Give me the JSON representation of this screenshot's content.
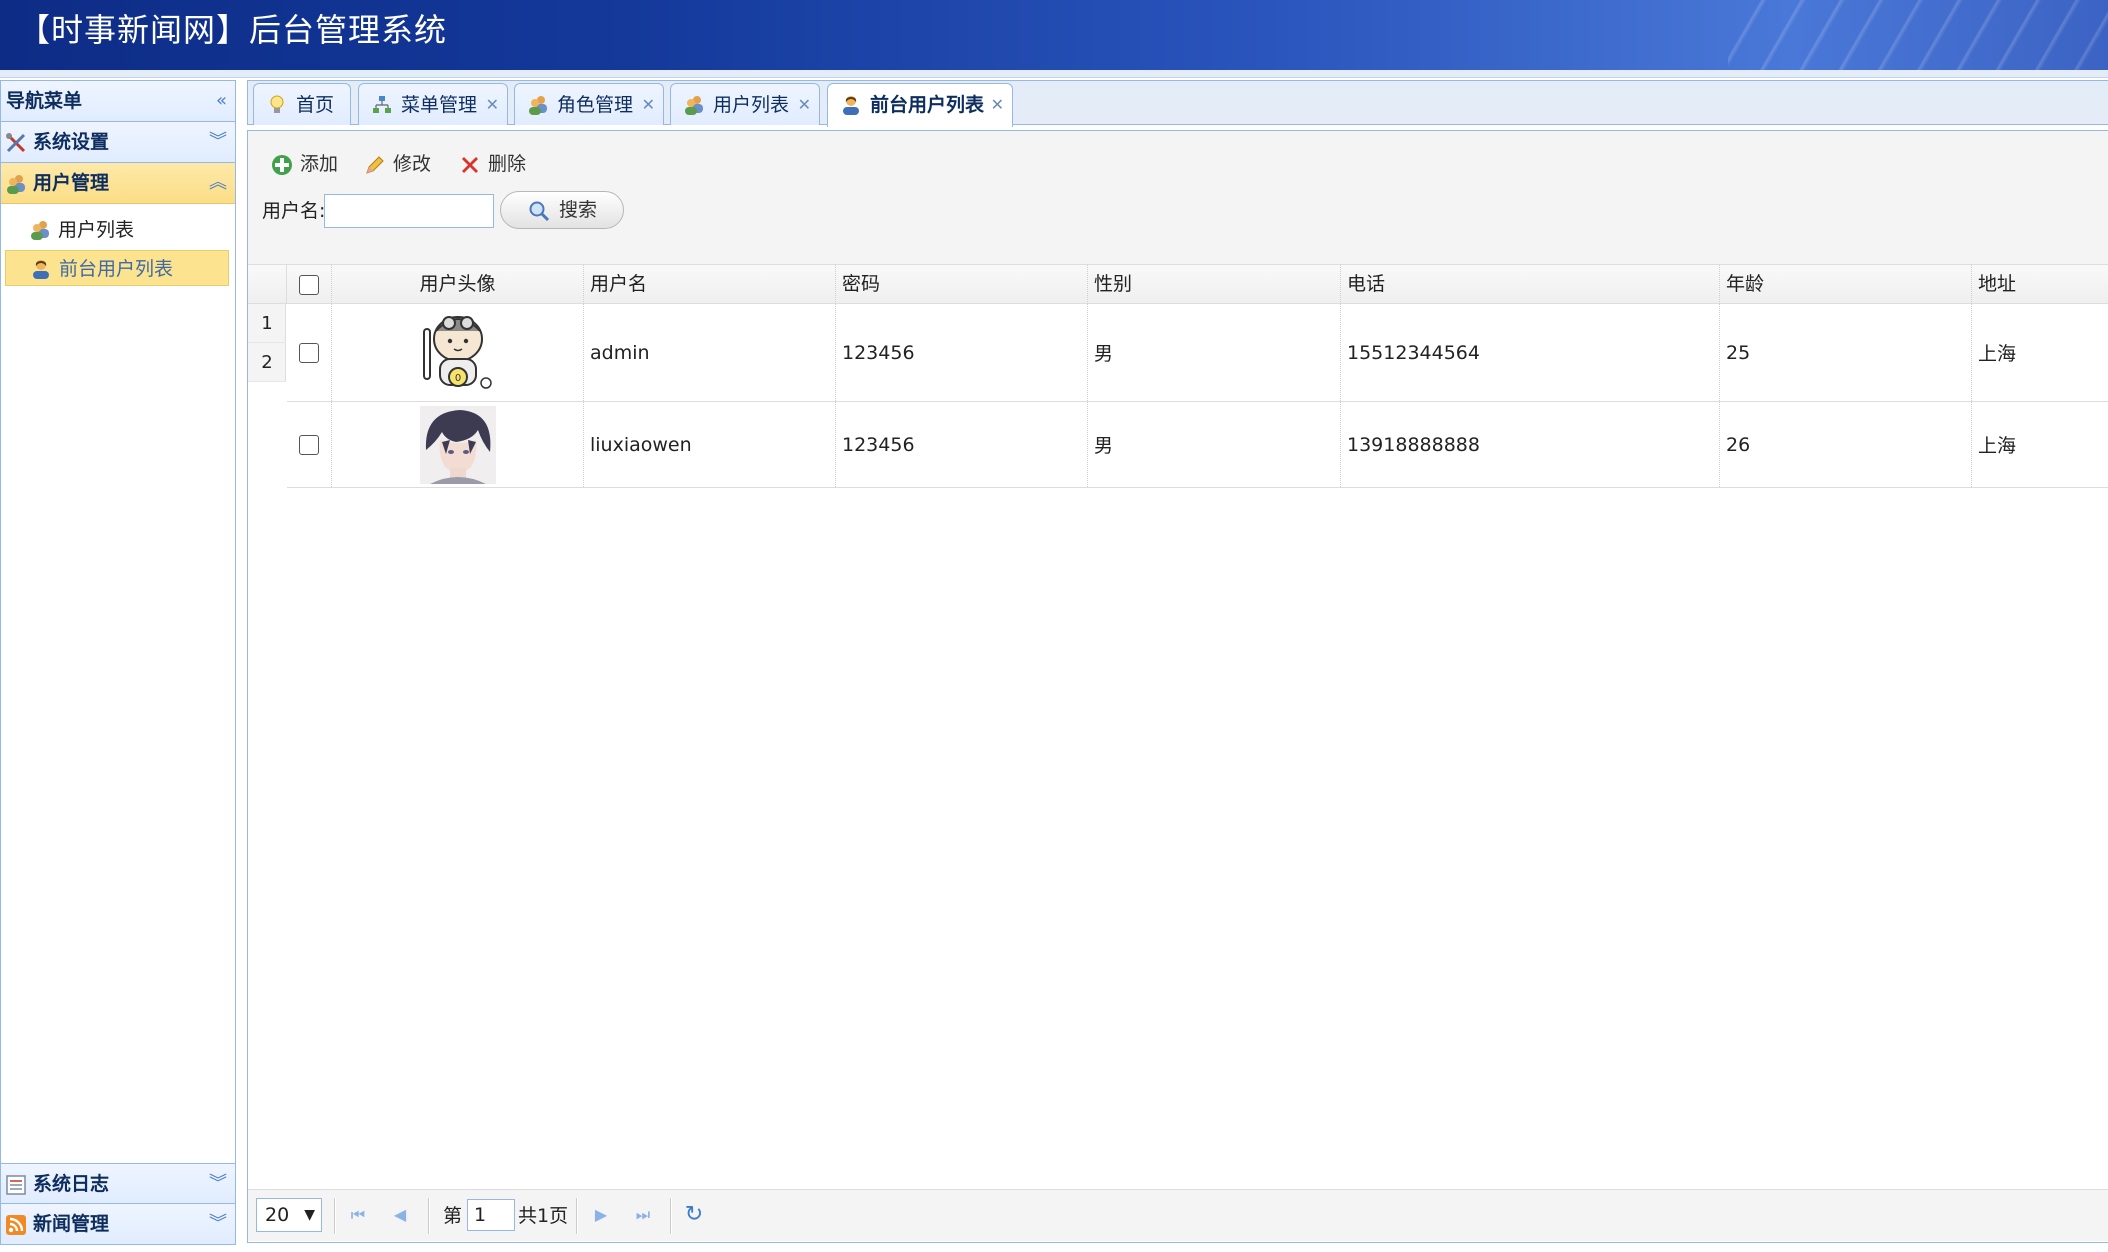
{
  "header": {
    "title": "【时事新闻网】后台管理系统"
  },
  "sidebar": {
    "title": "导航菜单",
    "collapse_icon": "double-chevron-left-icon",
    "panels": [
      {
        "label": "系统设置",
        "icon": "tools-icon",
        "state": "collapsed"
      },
      {
        "label": "用户管理",
        "icon": "users-icon",
        "state": "expanded",
        "selected": true,
        "items": [
          {
            "label": "用户列表",
            "icon": "users-icon"
          },
          {
            "label": "前台用户列表",
            "icon": "user-icon",
            "selected": true
          }
        ]
      },
      {
        "label": "系统日志",
        "icon": "log-icon",
        "state": "collapsed"
      },
      {
        "label": "新闻管理",
        "icon": "rss-icon",
        "state": "collapsed"
      }
    ]
  },
  "tabs": [
    {
      "label": "首页",
      "icon": "lightbulb-icon",
      "closable": false
    },
    {
      "label": "菜单管理",
      "icon": "sitemap-icon",
      "closable": true
    },
    {
      "label": "角色管理",
      "icon": "users-icon",
      "closable": true
    },
    {
      "label": "用户列表",
      "icon": "users-icon",
      "closable": true
    },
    {
      "label": "前台用户列表",
      "icon": "user-icon",
      "closable": true,
      "active": true
    }
  ],
  "toolbar": {
    "add_label": "添加",
    "edit_label": "修改",
    "delete_label": "删除",
    "search_label": "用户名:",
    "search_value": "",
    "search_button": "搜索"
  },
  "grid": {
    "columns": [
      "用户头像",
      "用户名",
      "密码",
      "性别",
      "电话",
      "年龄",
      "地址"
    ],
    "rownums": [
      "1",
      "2"
    ],
    "rows": [
      {
        "avatar": "cartoon-pilot-avatar",
        "username": "admin",
        "password": "123456",
        "gender": "男",
        "phone": "15512344564",
        "age": "25",
        "address": "上海"
      },
      {
        "avatar": "anime-boy-avatar",
        "username": "liuxiaowen",
        "password": "123456",
        "gender": "男",
        "phone": "13918888888",
        "age": "26",
        "address": "上海"
      }
    ]
  },
  "pager": {
    "page_size": "20",
    "page_prefix": "第",
    "page_number": "1",
    "page_total": "共1页"
  },
  "colors": {
    "header_dark": "#0d2c86",
    "panel_border": "#95b8e7",
    "selected_bg": "#fbe38f",
    "selected_text": "#416aa3"
  }
}
